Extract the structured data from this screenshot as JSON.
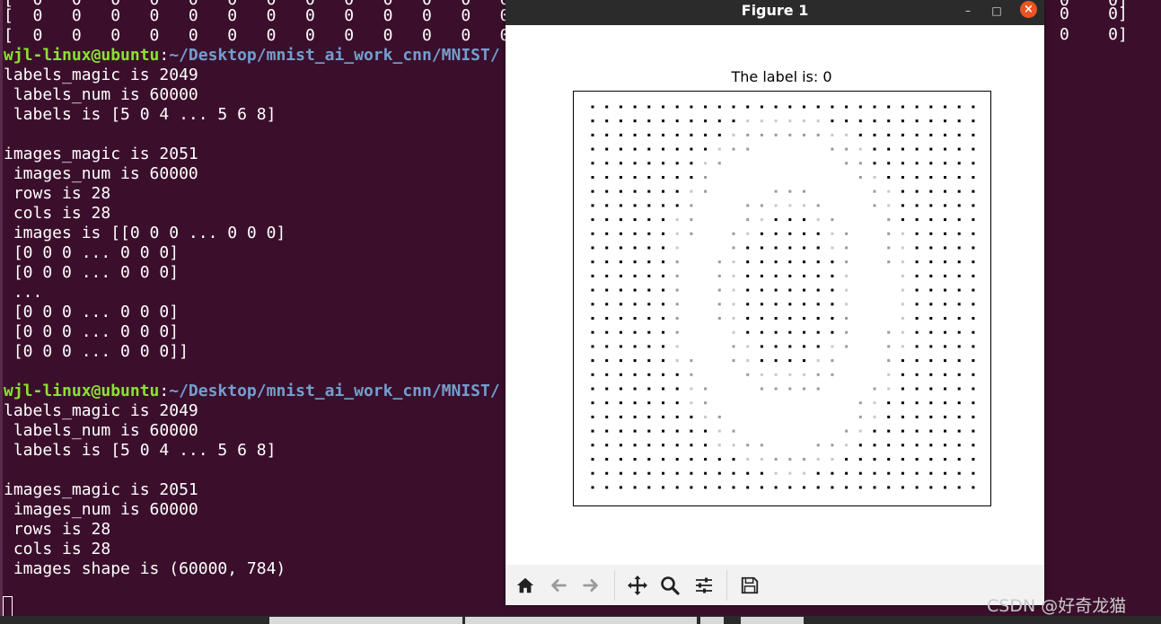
{
  "terminal": {
    "top_rows": [
      "[  0   0   0   0   0   0   0   0   0   0   0   0   0",
      "[  0   0   0   0   0   0   0   0   0   0   0   0   0"
    ],
    "right_fragments": [
      "0    0]",
      "0    0]",
      "0    0]"
    ],
    "prompt1": {
      "user": "wjl-linux@ubuntu",
      "sep": ":",
      "path": "~/Desktop/mnist_ai_work_cnn/MNIST/"
    },
    "block1": [
      "labels_magic is 2049",
      " labels_num is 60000",
      " labels is [5 0 4 ... 5 6 8]",
      "",
      "images_magic is 2051",
      " images_num is 60000",
      " rows is 28",
      " cols is 28",
      " images is [[0 0 0 ... 0 0 0]",
      " [0 0 0 ... 0 0 0]",
      " [0 0 0 ... 0 0 0]",
      " ...",
      " [0 0 0 ... 0 0 0]",
      " [0 0 0 ... 0 0 0]",
      " [0 0 0 ... 0 0 0]]",
      ""
    ],
    "prompt2": {
      "user": "wjl-linux@ubuntu",
      "sep": ":",
      "path": "~/Desktop/mnist_ai_work_cnn/MNIST/"
    },
    "block2": [
      "labels_magic is 2049",
      " labels_num is 60000",
      " labels is [5 0 4 ... 5 6 8]",
      "",
      "images_magic is 2051",
      " images_num is 60000",
      " rows is 28",
      " cols is 28",
      " images shape is (60000, 784)"
    ],
    "colors": {
      "background": "#3b0f2c",
      "user": "#8ae234",
      "path": "#729fcf"
    }
  },
  "window": {
    "title": "Figure 1",
    "min_glyph": "–",
    "max_glyph": "□",
    "close_glyph": "×"
  },
  "plot": {
    "title": "The label is: 0",
    "grid_size": 28
  },
  "toolbar": {
    "tools": [
      "home-icon",
      "back-arrow-icon",
      "forward-arrow-icon",
      "pan-icon",
      "zoom-icon",
      "configure-subplots-icon",
      "save-icon"
    ]
  },
  "watermark": "CSDN @好奇龙猫"
}
